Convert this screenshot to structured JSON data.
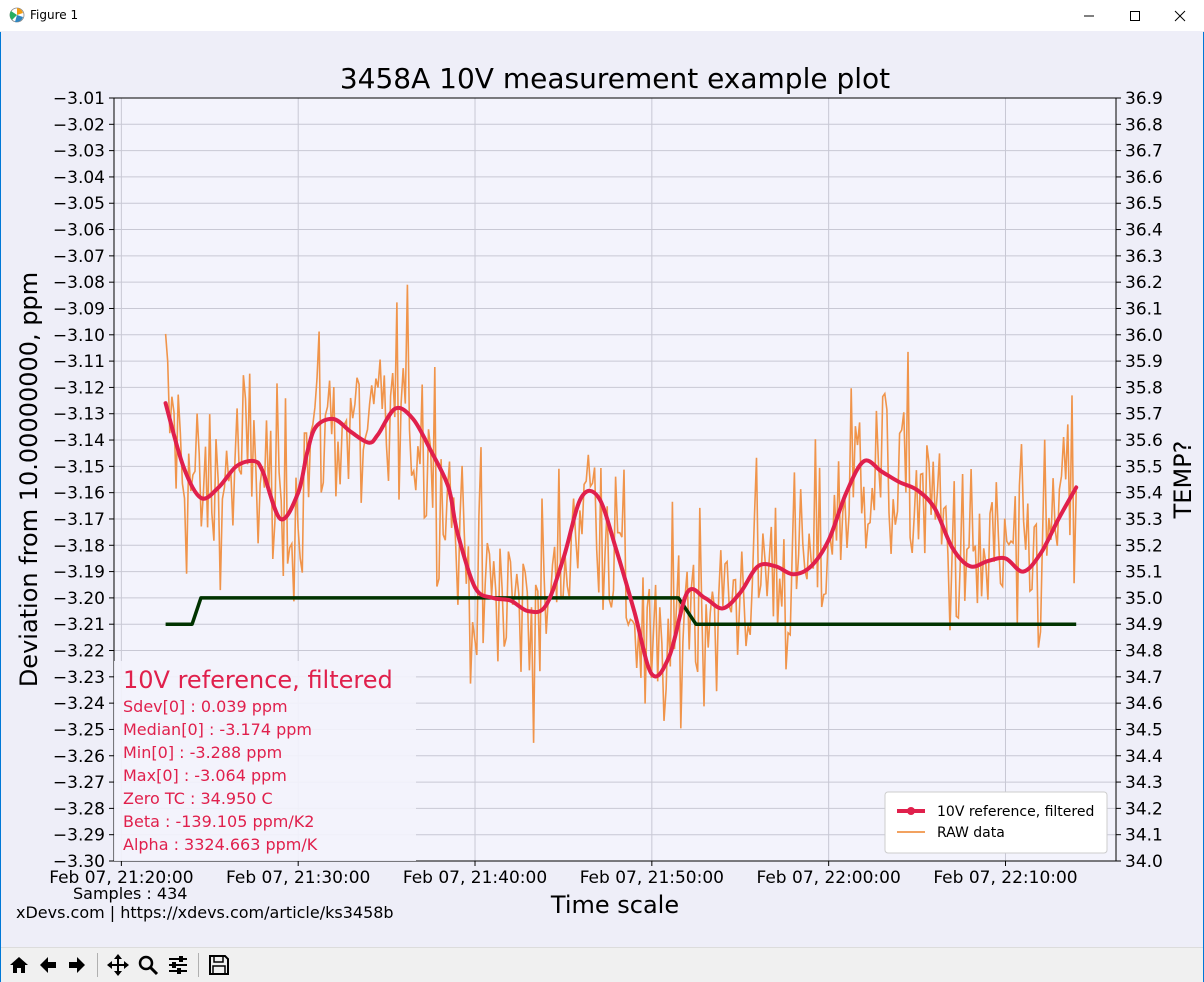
{
  "window": {
    "title": "Figure 1"
  },
  "chart_data": {
    "type": "line",
    "title": "3458A 10V measurement example plot",
    "xlabel": "Time scale",
    "ylabel": "Deviation from 10.00000000, ppm",
    "y2label": "TEMP?",
    "ylim": [
      -3.3,
      -3.01
    ],
    "y2lim": [
      34.0,
      36.9
    ],
    "xlim": [
      "2025-02-07 21:19:35",
      "2025-02-07 22:16:15"
    ],
    "yticks": [
      "−3.01",
      "−3.02",
      "−3.03",
      "−3.04",
      "−3.05",
      "−3.06",
      "−3.07",
      "−3.08",
      "−3.09",
      "−3.10",
      "−3.11",
      "−3.12",
      "−3.13",
      "−3.14",
      "−3.15",
      "−3.16",
      "−3.17",
      "−3.18",
      "−3.19",
      "−3.20",
      "−3.21",
      "−3.22",
      "−3.23",
      "−3.24",
      "−3.25",
      "−3.26",
      "−3.27",
      "−3.28",
      "−3.29",
      "−3.30"
    ],
    "y2ticks": [
      "36.9",
      "36.8",
      "36.7",
      "36.6",
      "36.5",
      "36.4",
      "36.3",
      "36.2",
      "36.1",
      "36.0",
      "35.9",
      "35.8",
      "35.7",
      "35.6",
      "35.5",
      "35.4",
      "35.3",
      "35.2",
      "35.1",
      "35.0",
      "34.9",
      "34.8",
      "34.7",
      "34.6",
      "34.5",
      "34.4",
      "34.3",
      "34.2",
      "34.1",
      "34.0"
    ],
    "xticks": [
      "Feb 07, 21:20:00",
      "Feb 07, 21:30:00",
      "Feb 07, 21:40:00",
      "Feb 07, 21:50:00",
      "Feb 07, 22:00:00",
      "Feb 07, 22:10:00"
    ],
    "grid": true,
    "legend_placement": "lower-right",
    "colors": {
      "filtered": "#e0204c",
      "raw": "#f0944a",
      "temp": "#003300",
      "stats": "#e0204c",
      "plot_bg": "#f3f3fc",
      "figure_bg": "#eeeef8"
    },
    "series": [
      {
        "name": "10V reference, filtered",
        "axis": "left",
        "x": [
          "21:22:30",
          "21:23:30",
          "21:24:30",
          "21:25:30",
          "21:26:30",
          "21:27:30",
          "21:28:00",
          "21:29:00",
          "21:30:00",
          "21:30:30",
          "21:31:00",
          "21:32:00",
          "21:33:00",
          "21:34:00",
          "21:34:30",
          "21:35:30",
          "21:36:30",
          "21:37:30",
          "21:38:30",
          "21:39:00",
          "21:40:00",
          "21:41:00",
          "21:42:00",
          "21:43:00",
          "21:44:00",
          "21:45:00",
          "21:46:00",
          "21:47:00",
          "21:48:00",
          "21:49:00",
          "21:50:00",
          "21:51:00",
          "21:52:00",
          "21:53:00",
          "21:54:00",
          "21:55:00",
          "21:56:00",
          "21:57:00",
          "21:58:00",
          "21:59:00",
          "22:00:00",
          "22:01:00",
          "22:02:00",
          "22:03:00",
          "22:04:00",
          "22:05:00",
          "22:06:00",
          "22:07:00",
          "22:08:00",
          "22:09:00",
          "22:10:00",
          "22:11:00",
          "22:12:00",
          "22:13:00",
          "22:14:00"
        ],
        "values": [
          -3.126,
          -3.15,
          -3.162,
          -3.158,
          -3.15,
          -3.148,
          -3.152,
          -3.17,
          -3.16,
          -3.145,
          -3.135,
          -3.132,
          -3.137,
          -3.141,
          -3.138,
          -3.128,
          -3.132,
          -3.144,
          -3.158,
          -3.175,
          -3.196,
          -3.2,
          -3.201,
          -3.205,
          -3.203,
          -3.185,
          -3.162,
          -3.162,
          -3.182,
          -3.205,
          -3.229,
          -3.222,
          -3.198,
          -3.2,
          -3.204,
          -3.198,
          -3.188,
          -3.188,
          -3.191,
          -3.188,
          -3.178,
          -3.16,
          -3.148,
          -3.152,
          -3.156,
          -3.159,
          -3.166,
          -3.181,
          -3.188,
          -3.186,
          -3.185,
          -3.19,
          -3.183,
          -3.17,
          -3.158
        ]
      },
      {
        "name": "RAW data",
        "axis": "left",
        "note_values": "434 noisy samples, mean around -3.17 ppm, range -3.288 to -3.064 ppm"
      },
      {
        "name": "",
        "axis": "right",
        "x": [
          "21:22:30",
          "21:24:00",
          "21:24:30",
          "21:51:30",
          "21:52:30",
          "22:14:00"
        ],
        "values": [
          34.9,
          34.9,
          35.0,
          35.0,
          34.9,
          34.9
        ]
      }
    ],
    "stats_box": {
      "heading": "10V reference, filtered",
      "lines": [
        "Sdev[0] : 0.039 ppm",
        "Median[0] : -3.174 ppm",
        "Min[0] : -3.288 ppm",
        "Max[0] : -3.064 ppm",
        "Zero TC : 34.950 C",
        "Beta : -139.105 ppm/K2",
        "Alpha : 3324.663 ppm/K"
      ]
    },
    "footer": {
      "samples": "Samples : 434",
      "credit": "xDevs.com | https://xdevs.com/article/ks3458b"
    },
    "legend": [
      {
        "label": "10V reference, filtered",
        "color": "#e0204c"
      },
      {
        "label": "RAW data",
        "color": "#f0944a"
      }
    ]
  },
  "toolbar": {
    "buttons": [
      {
        "name": "home-button",
        "icon": "home-icon"
      },
      {
        "name": "back-button",
        "icon": "arrow-left-icon"
      },
      {
        "name": "forward-button",
        "icon": "arrow-right-icon"
      },
      {
        "name": "pan-button",
        "icon": "move-icon"
      },
      {
        "name": "zoom-button",
        "icon": "magnifier-icon"
      },
      {
        "name": "configure-button",
        "icon": "sliders-icon"
      },
      {
        "name": "save-button",
        "icon": "floppy-icon"
      }
    ]
  }
}
